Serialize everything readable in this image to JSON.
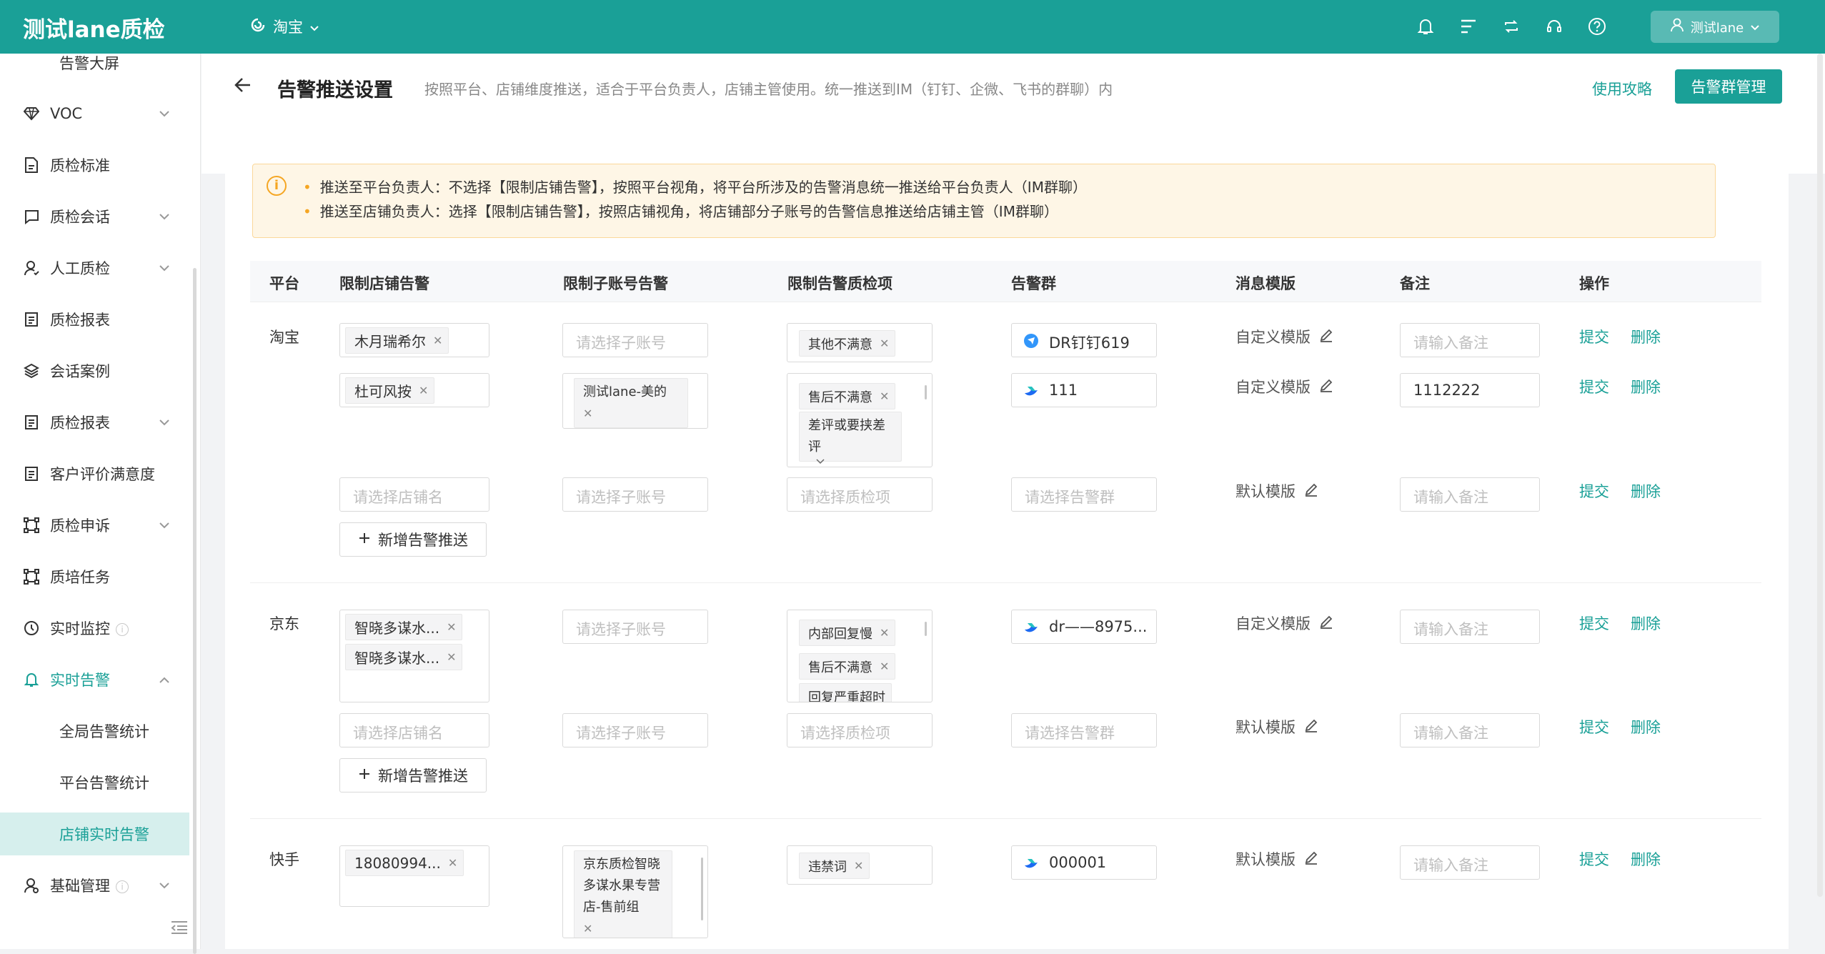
{
  "app": {
    "title": "测试lane质检"
  },
  "topbar": {
    "platform": "淘宝",
    "user": "测试lane",
    "icons": [
      "bell-icon",
      "list-icon",
      "switch-icon",
      "headset-icon",
      "help-icon"
    ]
  },
  "sidebar": {
    "items": [
      {
        "label": "告警大屏",
        "icon": ""
      },
      {
        "label": "VOC",
        "icon": "diamond-icon"
      },
      {
        "label": "质检标准",
        "icon": "document-icon"
      },
      {
        "label": "质检会话",
        "icon": "chat-icon"
      },
      {
        "label": "人工质检",
        "icon": "user-icon"
      },
      {
        "label": "质检报表",
        "icon": "report-icon"
      },
      {
        "label": "会话案例",
        "icon": "layers-icon"
      },
      {
        "label": "质检报表",
        "icon": "report-icon"
      },
      {
        "label": "客户评价满意度",
        "icon": "report-icon"
      },
      {
        "label": "质检申诉",
        "icon": "frame-icon"
      },
      {
        "label": "质培任务",
        "icon": "frame-icon"
      },
      {
        "label": "实时监控",
        "icon": "clock-icon"
      },
      {
        "label": "实时告警",
        "icon": "bell-icon"
      },
      {
        "label": "全局告警统计",
        "icon": ""
      },
      {
        "label": "平台告警统计",
        "icon": ""
      },
      {
        "label": "店铺实时告警",
        "icon": ""
      },
      {
        "label": "基础管理",
        "icon": "user-icon"
      }
    ]
  },
  "header": {
    "title": "告警推送设置",
    "description": "按照平台、店铺维度推送，适合于平台负责人，店铺主管使用。统一推送到IM（钉钉、企微、飞书的群聊）内",
    "guide_link": "使用攻略",
    "manage_button": "告警群管理"
  },
  "alert": {
    "lines": [
      "推送至平台负责人：不选择【限制店铺告警】，按照平台视角，将平台所涉及的告警消息统一推送给平台负责人（IM群聊）",
      "推送至店铺负责人：选择【限制店铺告警】，按照店铺视角，将店铺部分子账号的告警信息推送给店铺主管（IM群聊）"
    ]
  },
  "table": {
    "columns": [
      "平台",
      "限制店铺告警",
      "限制子账号告警",
      "限制告警质检项",
      "告警群",
      "消息模版",
      "备注",
      "操作"
    ],
    "placeholders": {
      "shop": "请选择店铺名",
      "account": "请选择子账号",
      "item": "请选择质检项",
      "group": "请选择告警群",
      "remark": "请输入备注"
    },
    "actions": {
      "submit": "提交",
      "delete": "删除"
    },
    "add_button": "新增告警推送",
    "platforms": [
      {
        "name": "淘宝",
        "rows": [
          {
            "shops": [
              "木月瑞希尔"
            ],
            "accounts": [],
            "items": [
              "其他不满意"
            ],
            "group": "DR钉钉619",
            "template": "自定义模版",
            "remark": ""
          },
          {
            "shops": [
              "杜可风按"
            ],
            "accounts": [
              "测试lane-美的"
            ],
            "items": [
              "售后不满意",
              "差评或要挟差评"
            ],
            "group": "111",
            "template": "自定义模版",
            "remark": "1112222"
          },
          {
            "shops": [],
            "accounts": [],
            "items": [],
            "group": "",
            "template": "默认模版",
            "remark": ""
          }
        ]
      },
      {
        "name": "京东",
        "rows": [
          {
            "shops": [
              "智晓多谋水...",
              "智晓多谋水..."
            ],
            "accounts": [],
            "items": [
              "内部回复慢",
              "售后不满意",
              "回复严重超时"
            ],
            "group": "dr——8975...",
            "template": "自定义模版",
            "remark": ""
          },
          {
            "shops": [],
            "accounts": [],
            "items": [],
            "group": "",
            "template": "默认模版",
            "remark": ""
          }
        ]
      },
      {
        "name": "快手",
        "rows": [
          {
            "shops": [
              "18080994..."
            ],
            "accounts": [
              "京东质检智晓多谋水果专营店-售前组"
            ],
            "items": [
              "违禁词"
            ],
            "group": "000001",
            "template": "默认模版",
            "remark": ""
          }
        ]
      }
    ]
  },
  "colors": {
    "primary": "#1aa097",
    "warning": "#f5a623",
    "alert_bg": "#fef6e6"
  }
}
